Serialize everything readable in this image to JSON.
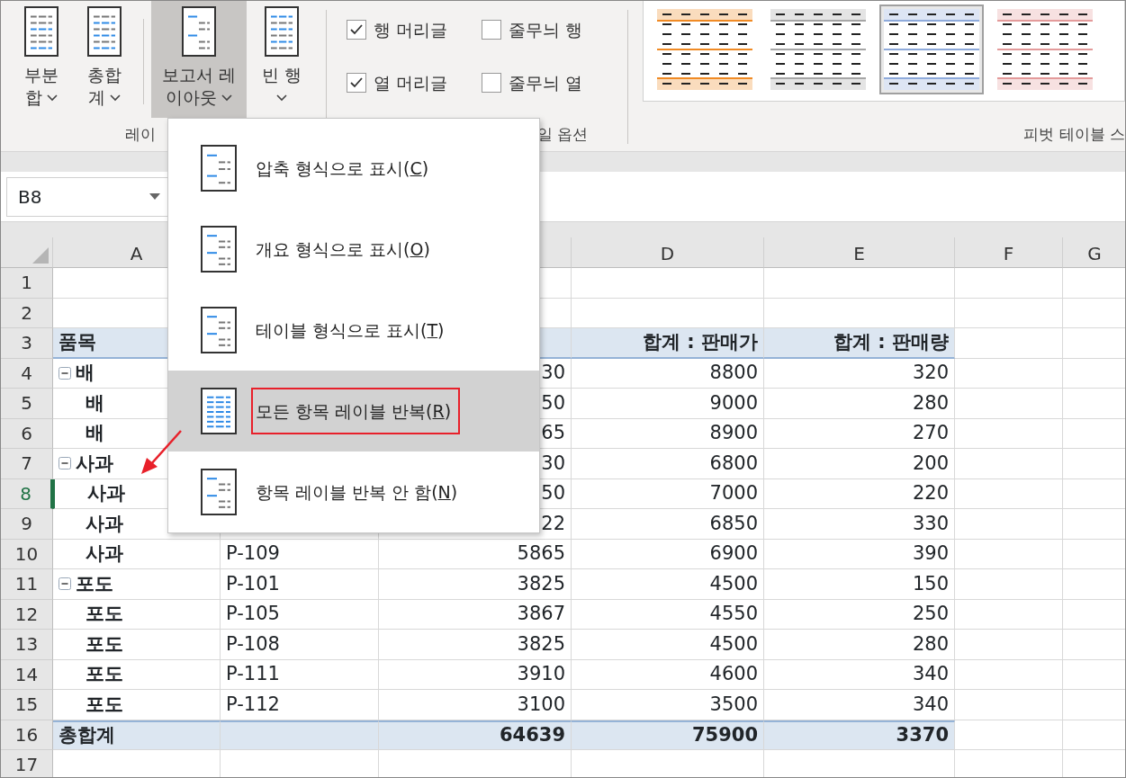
{
  "ribbon": {
    "layout_buttons": [
      {
        "lines": [
          "부분",
          "합"
        ],
        "kind": "subtotal",
        "selected": false
      },
      {
        "lines": [
          "총합",
          "계"
        ],
        "kind": "grandtotal",
        "selected": false
      },
      {
        "lines": [
          "보고서 레",
          "이아웃"
        ],
        "kind": "report",
        "selected": true
      },
      {
        "lines": [
          "빈 행"
        ],
        "kind": "blank",
        "selected": false
      }
    ],
    "layout_group_label": "레이",
    "style_options": [
      {
        "label": "행 머리글",
        "checked": true
      },
      {
        "label": "줄무늬 행",
        "checked": false
      },
      {
        "label": "열 머리글",
        "checked": true
      },
      {
        "label": "줄무늬 열",
        "checked": false
      }
    ],
    "style_options_group_label": "일 옵션",
    "styles": [
      {
        "color": "#f08a24",
        "selected": false
      },
      {
        "color": "#a6a6a6",
        "selected": false
      },
      {
        "color": "#8eaadb",
        "selected": true
      },
      {
        "color": "#e39a9a",
        "selected": false
      }
    ],
    "styles_group_label": "피벗 테이블 스"
  },
  "name_box": "B8",
  "sheet": {
    "columns": [
      "A",
      null,
      null,
      "D",
      "E",
      "F",
      "G"
    ],
    "rows": [
      {
        "number": "1",
        "kind": "blank",
        "selected": false,
        "cells": [
          null,
          null,
          null,
          null,
          null
        ]
      },
      {
        "number": "2",
        "kind": "blank",
        "selected": false,
        "cells": [
          null,
          null,
          null,
          null,
          null
        ]
      },
      {
        "number": "3",
        "kind": "header",
        "selected": false,
        "cells": [
          "품목",
          null,
          null,
          "합계 : 판매가",
          "합계 : 판매량"
        ]
      },
      {
        "number": "4",
        "kind": "group",
        "expanded": true,
        "selected": false,
        "cells": [
          "배",
          null,
          "30",
          "8800",
          "320"
        ]
      },
      {
        "number": "5",
        "kind": "item",
        "selected": false,
        "cells": [
          "배",
          null,
          "50",
          "9000",
          "280"
        ]
      },
      {
        "number": "6",
        "kind": "item",
        "selected": false,
        "cells": [
          "배",
          null,
          "65",
          "8900",
          "270"
        ]
      },
      {
        "number": "7",
        "kind": "group",
        "expanded": true,
        "selected": false,
        "cells": [
          "사과",
          null,
          "30",
          "6800",
          "200"
        ]
      },
      {
        "number": "8",
        "kind": "item",
        "selected": true,
        "cells": [
          "사과",
          null,
          "50",
          "7000",
          "220"
        ]
      },
      {
        "number": "9",
        "kind": "item",
        "selected": false,
        "cells": [
          "사과",
          null,
          "22",
          "6850",
          "330"
        ]
      },
      {
        "number": "10",
        "kind": "item",
        "selected": false,
        "cells": [
          "사과",
          "P-109",
          "5865",
          "6900",
          "390"
        ]
      },
      {
        "number": "11",
        "kind": "group",
        "expanded": true,
        "selected": false,
        "cells": [
          "포도",
          "P-101",
          "3825",
          "4500",
          "150"
        ]
      },
      {
        "number": "12",
        "kind": "item",
        "selected": false,
        "cells": [
          "포도",
          "P-105",
          "3867",
          "4550",
          "250"
        ]
      },
      {
        "number": "13",
        "kind": "item",
        "selected": false,
        "cells": [
          "포도",
          "P-108",
          "3825",
          "4500",
          "280"
        ]
      },
      {
        "number": "14",
        "kind": "item",
        "selected": false,
        "cells": [
          "포도",
          "P-111",
          "3910",
          "4600",
          "340"
        ]
      },
      {
        "number": "15",
        "kind": "item",
        "selected": false,
        "cells": [
          "포도",
          "P-112",
          "3100",
          "3500",
          "340"
        ]
      },
      {
        "number": "16",
        "kind": "total",
        "selected": false,
        "cells": [
          "총합계",
          null,
          "64639",
          "75900",
          "3370"
        ]
      },
      {
        "number": "17",
        "kind": "blank",
        "selected": false,
        "cells": [
          null,
          null,
          null,
          null,
          null
        ]
      }
    ]
  },
  "menu": {
    "items": [
      {
        "kind": "compact",
        "before": "압축 형식으로 표시(",
        "key": "C",
        "after": ")",
        "selected": false,
        "annotated": false
      },
      {
        "kind": "outline",
        "before": "개요 형식으로 표시(",
        "key": "O",
        "after": ")",
        "selected": false,
        "annotated": false
      },
      {
        "kind": "tabular",
        "before": "테이블 형식으로 표시(",
        "key": "T",
        "after": ")",
        "selected": false,
        "annotated": false
      },
      {
        "kind": "repeat",
        "before": "모든 항목 레이블 반복(",
        "key": "R",
        "after": ")",
        "selected": true,
        "annotated": true
      },
      {
        "kind": "norepeat",
        "before": "항목 레이블 반복 안 함(",
        "key": "N",
        "after": ")",
        "selected": false,
        "annotated": false
      }
    ]
  }
}
